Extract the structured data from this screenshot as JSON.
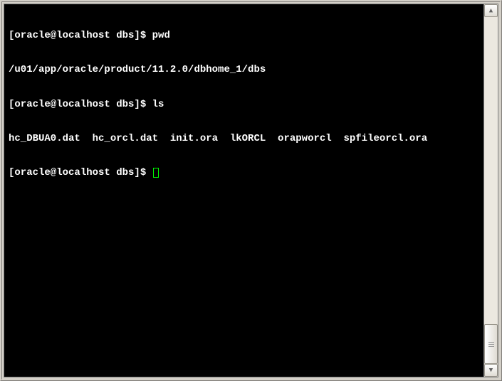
{
  "terminal": {
    "lines": [
      {
        "prompt": "[oracle@localhost dbs]$ ",
        "command": "pwd"
      },
      {
        "output": "/u01/app/oracle/product/11.2.0/dbhome_1/dbs"
      },
      {
        "prompt": "[oracle@localhost dbs]$ ",
        "command": "ls"
      },
      {
        "output": "hc_DBUA0.dat  hc_orcl.dat  init.ora  lkORCL  orapworcl  spfileorcl.ora"
      },
      {
        "prompt": "[oracle@localhost dbs]$ ",
        "command": "",
        "cursor": true
      }
    ]
  },
  "scrollbar": {
    "up_arrow": "▲",
    "down_arrow": "▼"
  }
}
